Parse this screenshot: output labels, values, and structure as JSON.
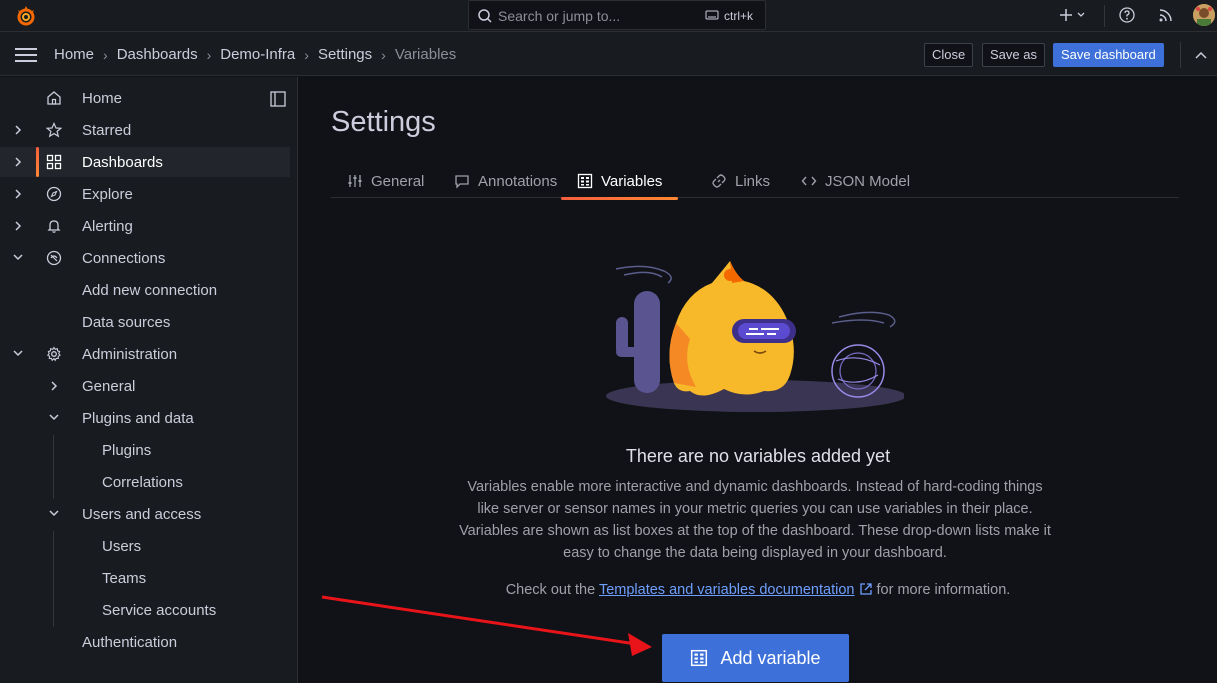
{
  "topbar": {
    "search_placeholder": "Search or jump to...",
    "search_shortcut": "ctrl+k"
  },
  "breadcrumbs": [
    "Home",
    "Dashboards",
    "Demo-Infra",
    "Settings",
    "Variables"
  ],
  "actions": {
    "close": "Close",
    "save_as": "Save as",
    "save_dashboard": "Save dashboard"
  },
  "sidebar": {
    "items": [
      {
        "label": "Home"
      },
      {
        "label": "Starred"
      },
      {
        "label": "Dashboards"
      },
      {
        "label": "Explore"
      },
      {
        "label": "Alerting"
      },
      {
        "label": "Connections"
      },
      {
        "label": "Add new connection"
      },
      {
        "label": "Data sources"
      },
      {
        "label": "Administration"
      },
      {
        "label": "General"
      },
      {
        "label": "Plugins and data"
      },
      {
        "label": "Plugins"
      },
      {
        "label": "Correlations"
      },
      {
        "label": "Users and access"
      },
      {
        "label": "Users"
      },
      {
        "label": "Teams"
      },
      {
        "label": "Service accounts"
      },
      {
        "label": "Authentication"
      }
    ]
  },
  "main": {
    "title": "Settings",
    "tabs": [
      {
        "label": "General"
      },
      {
        "label": "Annotations"
      },
      {
        "label": "Variables"
      },
      {
        "label": "Links"
      },
      {
        "label": "JSON Model"
      }
    ],
    "active_tab": "Variables",
    "empty_title": "There are no variables added yet",
    "empty_description": "Variables enable more interactive and dynamic dashboards. Instead of hard-coding things like server or sensor names in your metric queries you can use variables in their place. Variables are shown as list boxes at the top of the dashboard. These drop-down lists make it easy to change the data being displayed in your dashboard.",
    "link_prefix": "Check out the",
    "link_text": "Templates and variables documentation",
    "link_suffix": "for more information.",
    "add_button": "Add variable"
  },
  "colors": {
    "accent": "#3d71d9",
    "active_bar": "#f55f3e",
    "annotation_arrow": "#e8141a"
  }
}
